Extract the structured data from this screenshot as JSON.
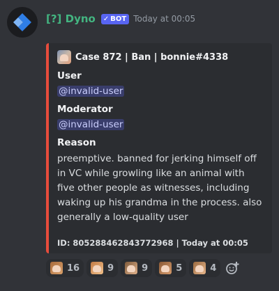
{
  "message": {
    "author": "[?] Dyno",
    "bot_tag": "BOT",
    "bot_check": "✓",
    "timestamp": "Today at 00:05"
  },
  "embed": {
    "accent_color": "#e74c3c",
    "author_name": "Case 872 | Ban | bonnie#4338",
    "fields": [
      {
        "name": "User",
        "value": "@invalid-user"
      },
      {
        "name": "Moderator",
        "value": "@invalid-user"
      },
      {
        "name": "Reason",
        "value": "preemptive. banned for jerking himself off in VC while growling like an animal with five other people as witnesses, including waking up his grandma in the process. also generally a low-quality user"
      }
    ],
    "footer": "ID: 805288462843772968 | Today at 00:05"
  },
  "reactions": [
    {
      "emoji": "anime-character-emoji",
      "count": "16"
    },
    {
      "emoji": "anime-character-emoji",
      "count": "9"
    },
    {
      "emoji": "anime-character-emoji",
      "count": "9"
    },
    {
      "emoji": "anime-character-emoji",
      "count": "5"
    },
    {
      "emoji": "anime-character-emoji",
      "count": "4"
    }
  ],
  "add_reaction_icon": "add-reaction-icon"
}
